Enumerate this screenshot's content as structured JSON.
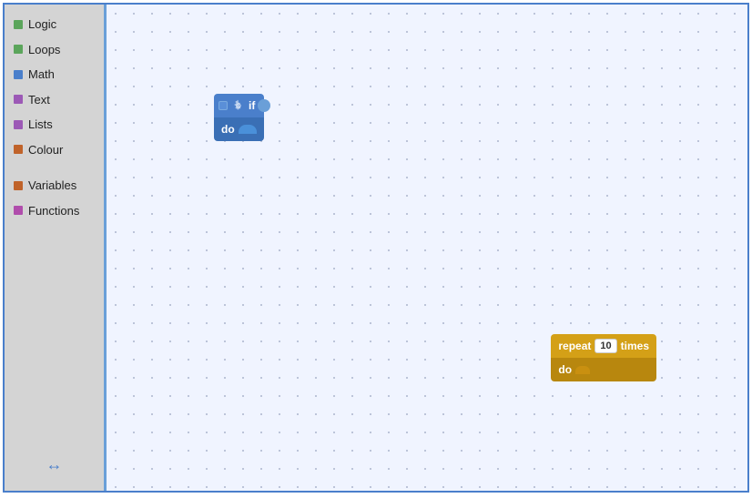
{
  "sidebar": {
    "items": [
      {
        "label": "Logic",
        "color": "#5ba55b"
      },
      {
        "label": "Loops",
        "color": "#5ba55b"
      },
      {
        "label": "Math",
        "color": "#4a7fcb"
      },
      {
        "label": "Text",
        "color": "#9c59b6"
      },
      {
        "label": "Lists",
        "color": "#9c59b6"
      },
      {
        "label": "Colour",
        "color": "#c0632a"
      },
      {
        "label": "Variables",
        "color": "#c0632a"
      },
      {
        "label": "Functions",
        "color": "#b04dac"
      }
    ]
  },
  "blocks": {
    "if_block": {
      "top_label": "if",
      "bottom_label": "do",
      "gear_icon": "⚙"
    },
    "repeat_block": {
      "prefix_label": "repeat",
      "input_value": "10",
      "suffix_label": "times",
      "bottom_label": "do"
    }
  },
  "resize_icon": "↔"
}
